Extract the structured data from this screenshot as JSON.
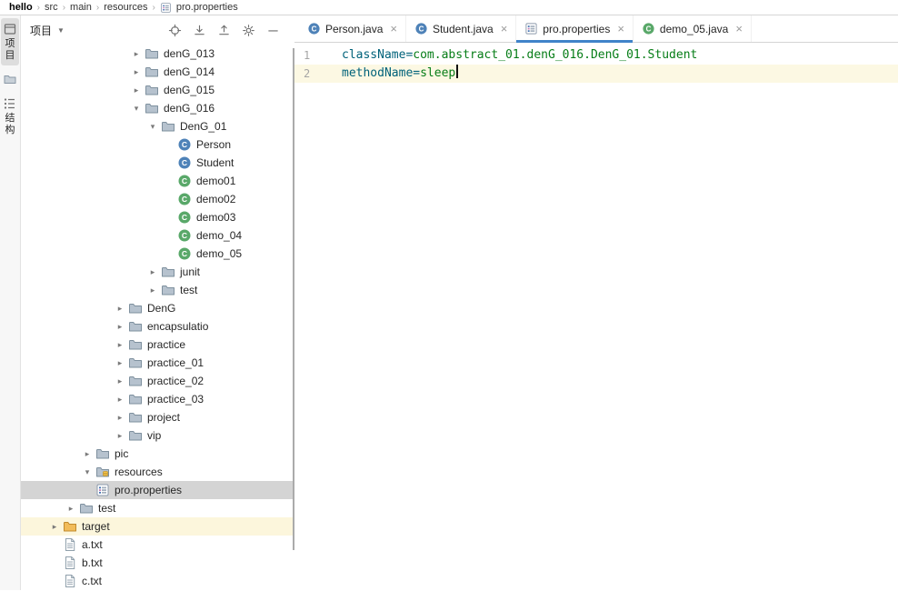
{
  "breadcrumb": {
    "items": [
      "hello",
      "src",
      "main",
      "resources",
      "pro.properties"
    ]
  },
  "tool_strip": {
    "project_label": "项目",
    "structure_label": "结构"
  },
  "project_panel": {
    "title": "项目",
    "header_icons": [
      "locate-file",
      "expand-all",
      "collapse-all",
      "settings-gear",
      "hide-panel"
    ],
    "tree": [
      {
        "label": "denG_013",
        "level": 6,
        "chevron": "collapsed",
        "icon": "folder"
      },
      {
        "label": "denG_014",
        "level": 6,
        "chevron": "collapsed",
        "icon": "folder"
      },
      {
        "label": "denG_015",
        "level": 6,
        "chevron": "collapsed",
        "icon": "folder"
      },
      {
        "label": "denG_016",
        "level": 6,
        "chevron": "expanded",
        "icon": "folder"
      },
      {
        "label": "DenG_01",
        "level": 7,
        "chevron": "expanded",
        "icon": "folder"
      },
      {
        "label": "Person",
        "level": 9,
        "icon": "class-blue"
      },
      {
        "label": "Student",
        "level": 9,
        "icon": "class-blue"
      },
      {
        "label": "demo01",
        "level": 9,
        "icon": "class-green"
      },
      {
        "label": "demo02",
        "level": 9,
        "icon": "class-green"
      },
      {
        "label": "demo03",
        "level": 9,
        "icon": "class-green"
      },
      {
        "label": "demo_04",
        "level": 9,
        "icon": "class-green"
      },
      {
        "label": "demo_05",
        "level": 9,
        "icon": "class-green"
      },
      {
        "label": "junit",
        "level": 7,
        "chevron": "collapsed",
        "icon": "folder"
      },
      {
        "label": "test",
        "level": 7,
        "chevron": "collapsed",
        "icon": "folder"
      },
      {
        "label": "DenG",
        "level": 5,
        "chevron": "collapsed",
        "icon": "folder"
      },
      {
        "label": "encapsulatio",
        "level": 5,
        "chevron": "collapsed",
        "icon": "folder"
      },
      {
        "label": "practice",
        "level": 5,
        "chevron": "collapsed",
        "icon": "folder"
      },
      {
        "label": "practice_01",
        "level": 5,
        "chevron": "collapsed",
        "icon": "folder"
      },
      {
        "label": "practice_02",
        "level": 5,
        "chevron": "collapsed",
        "icon": "folder"
      },
      {
        "label": "practice_03",
        "level": 5,
        "chevron": "collapsed",
        "icon": "folder"
      },
      {
        "label": "project",
        "level": 5,
        "chevron": "collapsed",
        "icon": "folder"
      },
      {
        "label": "vip",
        "level": 5,
        "chevron": "collapsed",
        "icon": "folder"
      },
      {
        "label": "pic",
        "level": 3,
        "chevron": "collapsed",
        "icon": "folder"
      },
      {
        "label": "resources",
        "level": 3,
        "chevron": "expanded",
        "icon": "folder-resources"
      },
      {
        "label": "pro.properties",
        "level": 4,
        "icon": "properties",
        "highlight": "selected"
      },
      {
        "label": "test",
        "level": 2,
        "chevron": "collapsed",
        "icon": "folder"
      },
      {
        "label": "target",
        "level": 1,
        "chevron": "collapsed",
        "icon": "folder-excluded",
        "highlight": "warm"
      },
      {
        "label": "a.txt",
        "level": 2,
        "icon": "text-file"
      },
      {
        "label": "b.txt",
        "level": 2,
        "icon": "text-file"
      },
      {
        "label": "c.txt",
        "level": 2,
        "icon": "text-file"
      }
    ]
  },
  "editor": {
    "tabs": [
      {
        "label": "Person.java",
        "icon": "class-blue",
        "active": false
      },
      {
        "label": "Student.java",
        "icon": "class-blue",
        "active": false
      },
      {
        "label": "pro.properties",
        "icon": "properties",
        "active": true
      },
      {
        "label": "demo_05.java",
        "icon": "class-green",
        "active": false
      }
    ],
    "lines": [
      {
        "number": "1",
        "current": false,
        "cursor": false,
        "segments": [
          {
            "type": "key",
            "text": "className"
          },
          {
            "type": "sep",
            "text": "="
          },
          {
            "type": "value",
            "text": "com.abstract_01.denG_016.DenG_01.Student"
          }
        ]
      },
      {
        "number": "2",
        "current": true,
        "cursor": true,
        "segments": [
          {
            "type": "key",
            "text": "methodName"
          },
          {
            "type": "sep",
            "text": "="
          },
          {
            "type": "value",
            "text": "sleep"
          }
        ]
      }
    ]
  },
  "colors": {
    "accent_tab_underline": "#4083C9",
    "selection_gray": "#D4D4D4",
    "caret_row": "#FCF8E3",
    "warm_row": "#FCF6DC",
    "properties_key": "#00627A",
    "properties_value": "#067D17"
  }
}
